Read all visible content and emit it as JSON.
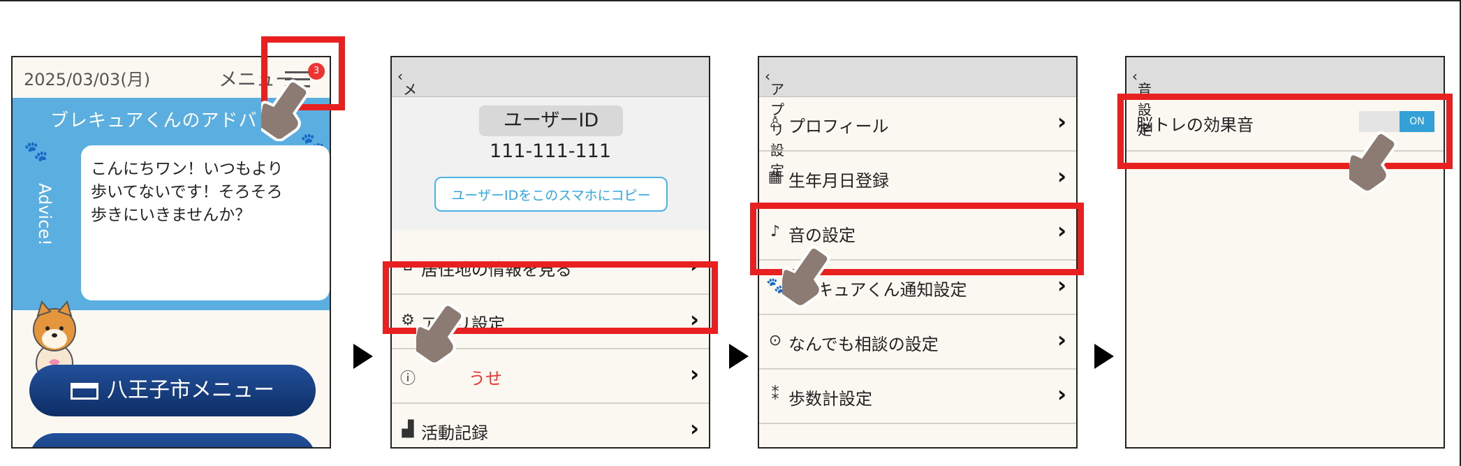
{
  "screen1": {
    "date": "2025/03/03(月)",
    "menu_label": "メニュー",
    "badge": "3",
    "advice_title": "ブレキュアくんのアドバ",
    "advice_side": "Advice!",
    "advice_text": "こんにちワン！いつもより\n歩いてないです！そろそろ\n歩きにいきませんか？",
    "city_menu": "八王子市メニュー"
  },
  "screen2": {
    "back": "メニュー",
    "user_id_label": "ユーザーID",
    "user_id_value": "111-111-111",
    "copy_button": "ユーザーIDをこのスマホにコピー",
    "items": [
      {
        "label": "居住地の情報を見る",
        "icon": "house-icon"
      },
      {
        "label": "アプリ設定",
        "icon": "gear-icon"
      },
      {
        "label": "うせ",
        "icon": "info-icon"
      },
      {
        "label": "活動記録",
        "icon": "chart-icon"
      }
    ]
  },
  "screen3": {
    "back": "アプリ設定",
    "items": [
      {
        "label": "プロフィール",
        "icon": "person-icon"
      },
      {
        "label": "生年月日登録",
        "icon": "calendar-icon"
      },
      {
        "label": "音の設定",
        "icon": "music-note-icon"
      },
      {
        "label": "キュアくん通知設定",
        "icon": "paw-icon"
      },
      {
        "label": "なんでも相談の設定",
        "icon": "chevron-circle-icon"
      },
      {
        "label": "歩数計設定",
        "icon": "footprint-icon"
      }
    ]
  },
  "screen4": {
    "back": "音設定",
    "toggle_label": "脳トレの効果音",
    "toggle_state": "ON"
  },
  "colors": {
    "highlight": "#e82020",
    "advice_blue": "#5aaee0",
    "city_button": "#1c4488",
    "toggle_on": "#33a0d8",
    "alert_red": "#e33333"
  }
}
